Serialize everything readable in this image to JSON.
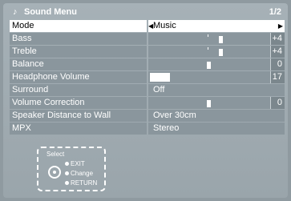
{
  "header": {
    "icon": "music-note-icon",
    "title": "Sound Menu",
    "page": "1/2"
  },
  "rows": [
    {
      "label": "Mode",
      "value": "Music"
    },
    {
      "label": "Bass",
      "value": "+4",
      "level": 0.6
    },
    {
      "label": "Treble",
      "value": "+4",
      "level": 0.6
    },
    {
      "label": "Balance",
      "value": "0",
      "level": 0.5
    },
    {
      "label": "Headphone Volume",
      "value": "17",
      "level": 0.17
    },
    {
      "label": "Surround",
      "value": "Off"
    },
    {
      "label": "Volume Correction",
      "value": "0",
      "level": 0.5
    },
    {
      "label": "Speaker Distance to Wall",
      "value": "Over 30cm"
    },
    {
      "label": "MPX",
      "value": "Stereo"
    }
  ],
  "help": {
    "select": "Select",
    "exit": "EXIT",
    "change": "Change",
    "return": "RETURN"
  },
  "colors": {
    "background": "#9aa5ab",
    "row": "#8a969d",
    "selected": "#ffffff"
  }
}
